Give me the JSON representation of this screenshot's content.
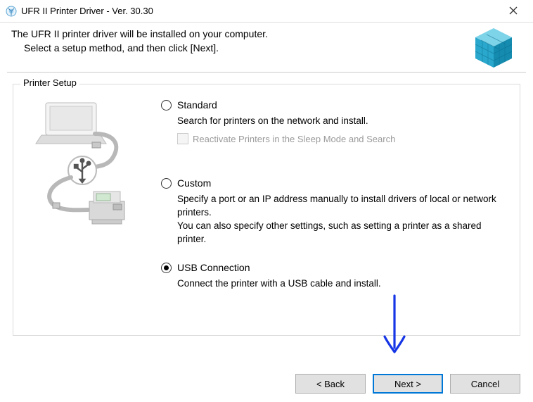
{
  "window": {
    "title": "UFR II Printer Driver - Ver. 30.30"
  },
  "header": {
    "line1": "The UFR II printer driver will be installed on your computer.",
    "line2": "Select a setup method, and then click [Next]."
  },
  "group": {
    "title": "Printer Setup",
    "options": {
      "standard": {
        "label": "Standard",
        "desc": "Search for printers on the network and install.",
        "sub_checkbox_label": "Reactivate Printers in the Sleep Mode and Search"
      },
      "custom": {
        "label": "Custom",
        "desc": "Specify a port or an IP address manually to install drivers of local or network printers.\nYou can also specify other settings, such as setting a printer as a shared printer."
      },
      "usb": {
        "label": "USB Connection",
        "desc": "Connect the printer with a USB cable and install."
      }
    }
  },
  "buttons": {
    "back": "< Back",
    "next": "Next >",
    "cancel": "Cancel"
  }
}
